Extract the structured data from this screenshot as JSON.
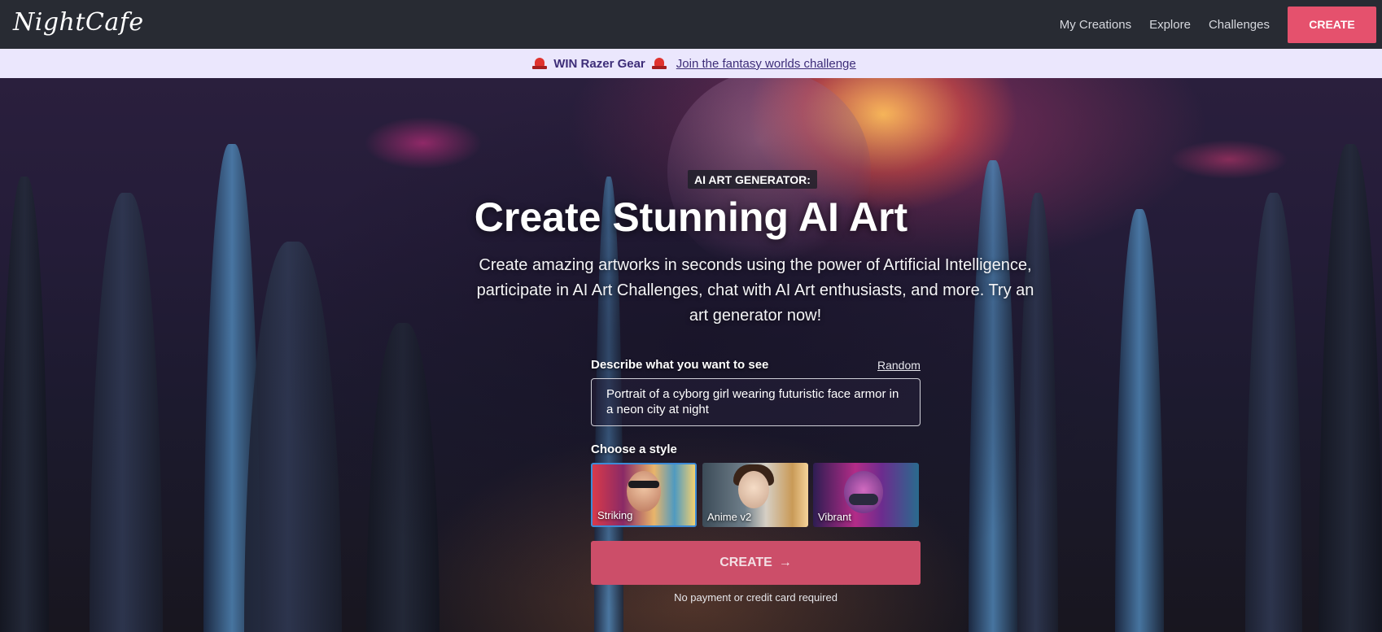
{
  "header": {
    "logo": "NightCafe",
    "nav": [
      "My Creations",
      "Explore",
      "Challenges"
    ],
    "create_label": "CREATE"
  },
  "banner": {
    "icon": "alarm-light-icon",
    "strong_text": "WIN Razer Gear",
    "link_text": "Join the fantasy worlds challenge",
    "background": "#ebe7fd",
    "text_color": "#3d2d78"
  },
  "hero": {
    "tagline": "AI ART GENERATOR:",
    "headline": "Create Stunning AI Art",
    "subhead": "Create amazing artworks in seconds using the power of Artificial Intelligence, participate in AI Art Challenges, chat with AI Art enthusiasts, and more. Try an art generator now!",
    "prompt_label": "Describe what you want to see",
    "random_label": "Random",
    "prompt_value": "Portrait of a cyborg girl wearing futuristic face armor in a neon city at night",
    "style_label": "Choose a style",
    "styles": [
      {
        "name": "Striking",
        "selected": true
      },
      {
        "name": "Anime v2",
        "selected": false
      },
      {
        "name": "Vibrant",
        "selected": false
      }
    ],
    "create_label": "CREATE",
    "create_icon": "arrow-right-icon",
    "fine_print": "No payment or credit card required"
  },
  "colors": {
    "accent": "#e5516d",
    "topbar": "#282b33",
    "selected_border": "#3d8bd6"
  }
}
